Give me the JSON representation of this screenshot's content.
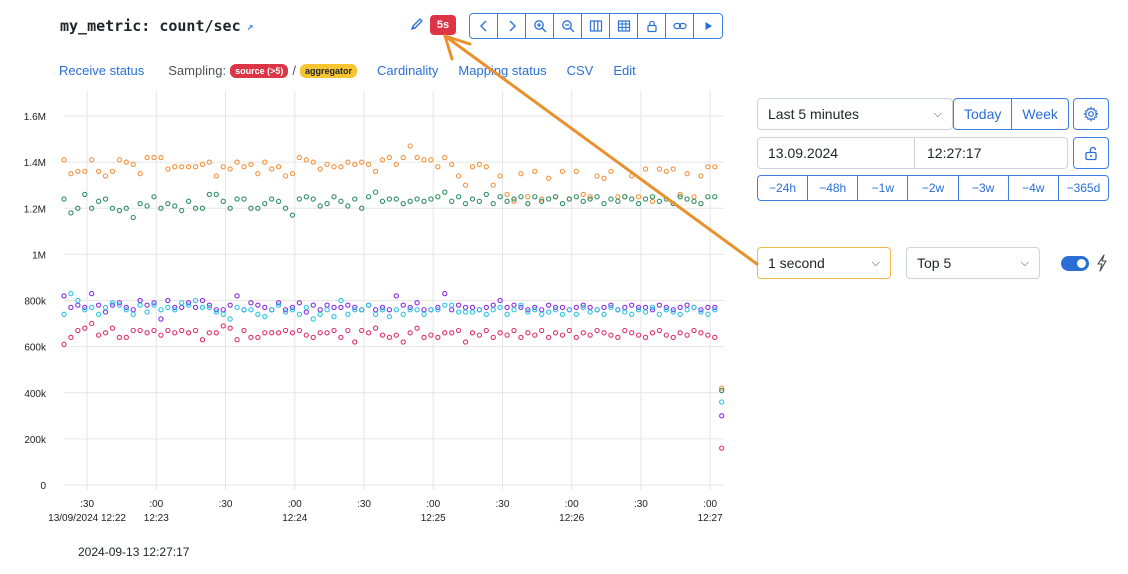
{
  "header": {
    "title": "my_metric: count/sec",
    "live_badge": "5s"
  },
  "links": {
    "receive_status": "Receive status",
    "sampling_label": "Sampling:",
    "sampling_source": "source (>5)",
    "sampling_sep": "/",
    "sampling_aggregator": "aggregator",
    "cardinality": "Cardinality",
    "mapping_status": "Mapping status",
    "csv": "CSV",
    "edit": "Edit"
  },
  "controls": {
    "range": "Last 5 minutes",
    "today": "Today",
    "week": "Week",
    "date": "13.09.2024",
    "time": "12:27:17",
    "shifts": [
      "−24h",
      "−48h",
      "−1w",
      "−2w",
      "−3w",
      "−4w",
      "−365d"
    ],
    "interval": "1 second",
    "top": "Top 5"
  },
  "footer": {
    "timestamp": "2024-09-13 12:27:17"
  },
  "colors": {
    "accent": "#2a6fd6",
    "danger": "#dc3545",
    "warning": "#f7c532",
    "arrow": "#e8912e"
  },
  "chart_data": {
    "type": "scatter",
    "title": "",
    "xlabel": "",
    "ylabel": "",
    "ylim": [
      0,
      1600000
    ],
    "y_ticks": [
      "0",
      "200k",
      "400k",
      "600k",
      "800k",
      "1M",
      "1.2M",
      "1.4M",
      "1.6M"
    ],
    "y_tick_values": [
      0,
      200000,
      400000,
      600000,
      800000,
      1000000,
      1200000,
      1400000,
      1600000
    ],
    "x_ticks": [
      {
        "label": ":30",
        "sub": "13/09/2024 12:22",
        "t": 30
      },
      {
        "label": ":00",
        "sub": "12:23",
        "t": 60
      },
      {
        "label": ":30",
        "sub": "",
        "t": 90
      },
      {
        "label": ":00",
        "sub": "12:24",
        "t": 120
      },
      {
        "label": ":30",
        "sub": "",
        "t": 150
      },
      {
        "label": ":00",
        "sub": "12:25",
        "t": 180
      },
      {
        "label": ":30",
        "sub": "",
        "t": 210
      },
      {
        "label": ":00",
        "sub": "12:26",
        "t": 240
      },
      {
        "label": ":30",
        "sub": "",
        "t": 270
      },
      {
        "label": ":00",
        "sub": "12:27",
        "t": 300
      }
    ],
    "x_range": [
      20,
      306
    ],
    "x": [
      20,
      23,
      26,
      29,
      32,
      35,
      38,
      41,
      44,
      47,
      50,
      53,
      56,
      59,
      62,
      65,
      68,
      71,
      74,
      77,
      80,
      83,
      86,
      89,
      92,
      95,
      98,
      101,
      104,
      107,
      110,
      113,
      116,
      119,
      122,
      125,
      128,
      131,
      134,
      137,
      140,
      143,
      146,
      149,
      152,
      155,
      158,
      161,
      164,
      167,
      170,
      173,
      176,
      179,
      182,
      185,
      188,
      191,
      194,
      197,
      200,
      203,
      206,
      209,
      212,
      215,
      218,
      221,
      224,
      227,
      230,
      233,
      236,
      239,
      242,
      245,
      248,
      251,
      254,
      257,
      260,
      263,
      266,
      269,
      272,
      275,
      278,
      281,
      284,
      287,
      290,
      293,
      296,
      299,
      302,
      305
    ],
    "series": [
      {
        "color": "#f5923e",
        "values": [
          1410000,
          1350000,
          1360000,
          1360000,
          1410000,
          1360000,
          1340000,
          1360000,
          1410000,
          1400000,
          1390000,
          1350000,
          1420000,
          1420000,
          1420000,
          1370000,
          1380000,
          1380000,
          1380000,
          1380000,
          1390000,
          1400000,
          1340000,
          1380000,
          1370000,
          1400000,
          1380000,
          1390000,
          1350000,
          1400000,
          1370000,
          1380000,
          1340000,
          1350000,
          1420000,
          1410000,
          1400000,
          1370000,
          1390000,
          1380000,
          1380000,
          1400000,
          1390000,
          1400000,
          1390000,
          1360000,
          1410000,
          1420000,
          1390000,
          1420000,
          1470000,
          1420000,
          1410000,
          1410000,
          1380000,
          1420000,
          1390000,
          1340000,
          1300000,
          1380000,
          1390000,
          1380000,
          1300000,
          1340000,
          1260000,
          1230000,
          1350000,
          1250000,
          1360000,
          1240000,
          1330000,
          1250000,
          1360000,
          1240000,
          1360000,
          1260000,
          1250000,
          1340000,
          1330000,
          1360000,
          1250000,
          1250000,
          1340000,
          1250000,
          1370000,
          1230000,
          1370000,
          1360000,
          1370000,
          1260000,
          1350000,
          1250000,
          1340000,
          1380000,
          1380000,
          420000
        ]
      },
      {
        "color": "#2f8f63",
        "values": [
          1240000,
          1180000,
          1200000,
          1260000,
          1200000,
          1230000,
          1240000,
          1200000,
          1190000,
          1200000,
          1160000,
          1220000,
          1210000,
          1250000,
          1200000,
          1220000,
          1210000,
          1190000,
          1230000,
          1200000,
          1200000,
          1260000,
          1260000,
          1230000,
          1200000,
          1240000,
          1240000,
          1200000,
          1200000,
          1220000,
          1240000,
          1230000,
          1200000,
          1170000,
          1240000,
          1250000,
          1240000,
          1210000,
          1220000,
          1250000,
          1230000,
          1210000,
          1240000,
          1200000,
          1250000,
          1270000,
          1230000,
          1240000,
          1240000,
          1220000,
          1230000,
          1240000,
          1230000,
          1240000,
          1250000,
          1270000,
          1230000,
          1250000,
          1220000,
          1240000,
          1230000,
          1260000,
          1220000,
          1250000,
          1230000,
          1240000,
          1250000,
          1220000,
          1250000,
          1230000,
          1240000,
          1250000,
          1220000,
          1240000,
          1250000,
          1230000,
          1240000,
          1250000,
          1220000,
          1240000,
          1230000,
          1250000,
          1240000,
          1220000,
          1240000,
          1250000,
          1230000,
          1240000,
          1220000,
          1250000,
          1240000,
          1230000,
          1220000,
          1250000,
          1250000,
          410000
        ]
      },
      {
        "color": "#8a2be2",
        "values": [
          820000,
          770000,
          780000,
          770000,
          830000,
          780000,
          750000,
          780000,
          790000,
          770000,
          760000,
          800000,
          780000,
          790000,
          720000,
          800000,
          770000,
          770000,
          790000,
          770000,
          800000,
          780000,
          760000,
          760000,
          780000,
          820000,
          760000,
          790000,
          780000,
          770000,
          760000,
          790000,
          760000,
          770000,
          790000,
          750000,
          780000,
          760000,
          780000,
          770000,
          770000,
          780000,
          770000,
          760000,
          780000,
          760000,
          770000,
          760000,
          820000,
          780000,
          770000,
          790000,
          760000,
          760000,
          770000,
          830000,
          760000,
          780000,
          770000,
          770000,
          760000,
          770000,
          780000,
          800000,
          770000,
          780000,
          770000,
          760000,
          770000,
          760000,
          780000,
          770000,
          770000,
          760000,
          770000,
          780000,
          770000,
          760000,
          770000,
          780000,
          760000,
          770000,
          780000,
          770000,
          770000,
          760000,
          780000,
          770000,
          760000,
          770000,
          780000,
          770000,
          760000,
          770000,
          770000,
          300000
        ]
      },
      {
        "color": "#29c5e6",
        "values": [
          740000,
          830000,
          800000,
          760000,
          770000,
          740000,
          770000,
          790000,
          780000,
          760000,
          740000,
          780000,
          750000,
          780000,
          760000,
          770000,
          760000,
          790000,
          780000,
          800000,
          770000,
          770000,
          750000,
          740000,
          720000,
          770000,
          760000,
          760000,
          740000,
          730000,
          760000,
          780000,
          750000,
          760000,
          740000,
          770000,
          720000,
          740000,
          760000,
          730000,
          800000,
          740000,
          760000,
          760000,
          780000,
          740000,
          760000,
          730000,
          760000,
          740000,
          760000,
          760000,
          740000,
          760000,
          760000,
          780000,
          780000,
          750000,
          750000,
          750000,
          760000,
          740000,
          760000,
          770000,
          740000,
          760000,
          780000,
          750000,
          760000,
          740000,
          750000,
          760000,
          740000,
          760000,
          740000,
          770000,
          750000,
          760000,
          740000,
          770000,
          760000,
          750000,
          740000,
          760000,
          750000,
          770000,
          740000,
          760000,
          750000,
          740000,
          760000,
          770000,
          750000,
          740000,
          760000,
          360000
        ]
      },
      {
        "color": "#e0336b",
        "values": [
          610000,
          640000,
          670000,
          680000,
          700000,
          650000,
          660000,
          680000,
          640000,
          640000,
          670000,
          670000,
          660000,
          670000,
          650000,
          670000,
          660000,
          670000,
          660000,
          670000,
          630000,
          660000,
          660000,
          690000,
          680000,
          630000,
          670000,
          640000,
          640000,
          660000,
          660000,
          660000,
          670000,
          660000,
          670000,
          650000,
          640000,
          660000,
          660000,
          670000,
          640000,
          670000,
          620000,
          670000,
          660000,
          680000,
          650000,
          640000,
          650000,
          620000,
          660000,
          680000,
          640000,
          650000,
          640000,
          660000,
          660000,
          670000,
          620000,
          660000,
          650000,
          670000,
          640000,
          660000,
          650000,
          670000,
          640000,
          660000,
          650000,
          670000,
          640000,
          660000,
          650000,
          670000,
          640000,
          660000,
          650000,
          670000,
          660000,
          650000,
          640000,
          670000,
          660000,
          650000,
          640000,
          660000,
          670000,
          650000,
          640000,
          660000,
          650000,
          670000,
          660000,
          650000,
          640000,
          160000
        ]
      }
    ]
  }
}
